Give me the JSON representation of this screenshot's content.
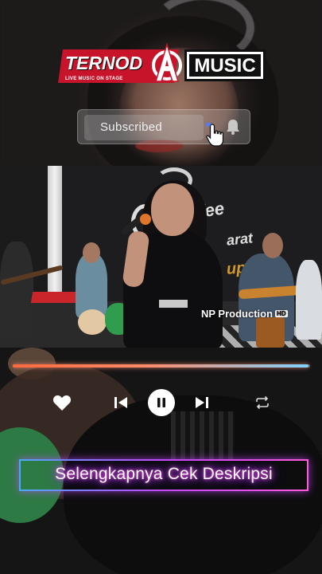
{
  "logo": {
    "brand": "TERNOD",
    "tagline": "LIVE MUSIC ON STAGE",
    "music": "MUSIC"
  },
  "subscribe": {
    "label": "Subscribed",
    "icon": "bell-icon"
  },
  "video": {
    "watermark": "NP Production",
    "badge": "HD",
    "wall_text_1": "offee",
    "wall_text_2": "arat",
    "wall_text_3": "up"
  },
  "player": {
    "progress": 0.995,
    "accent_start": "#ff6a3c",
    "accent_end": "#7fd3ff",
    "buttons": [
      "heart-icon",
      "previous-icon",
      "pause-icon",
      "next-icon",
      "repeat-icon"
    ]
  },
  "caption": {
    "text": "Selengkapnya Cek Deskripsi",
    "glow_color": "#c03cff"
  }
}
